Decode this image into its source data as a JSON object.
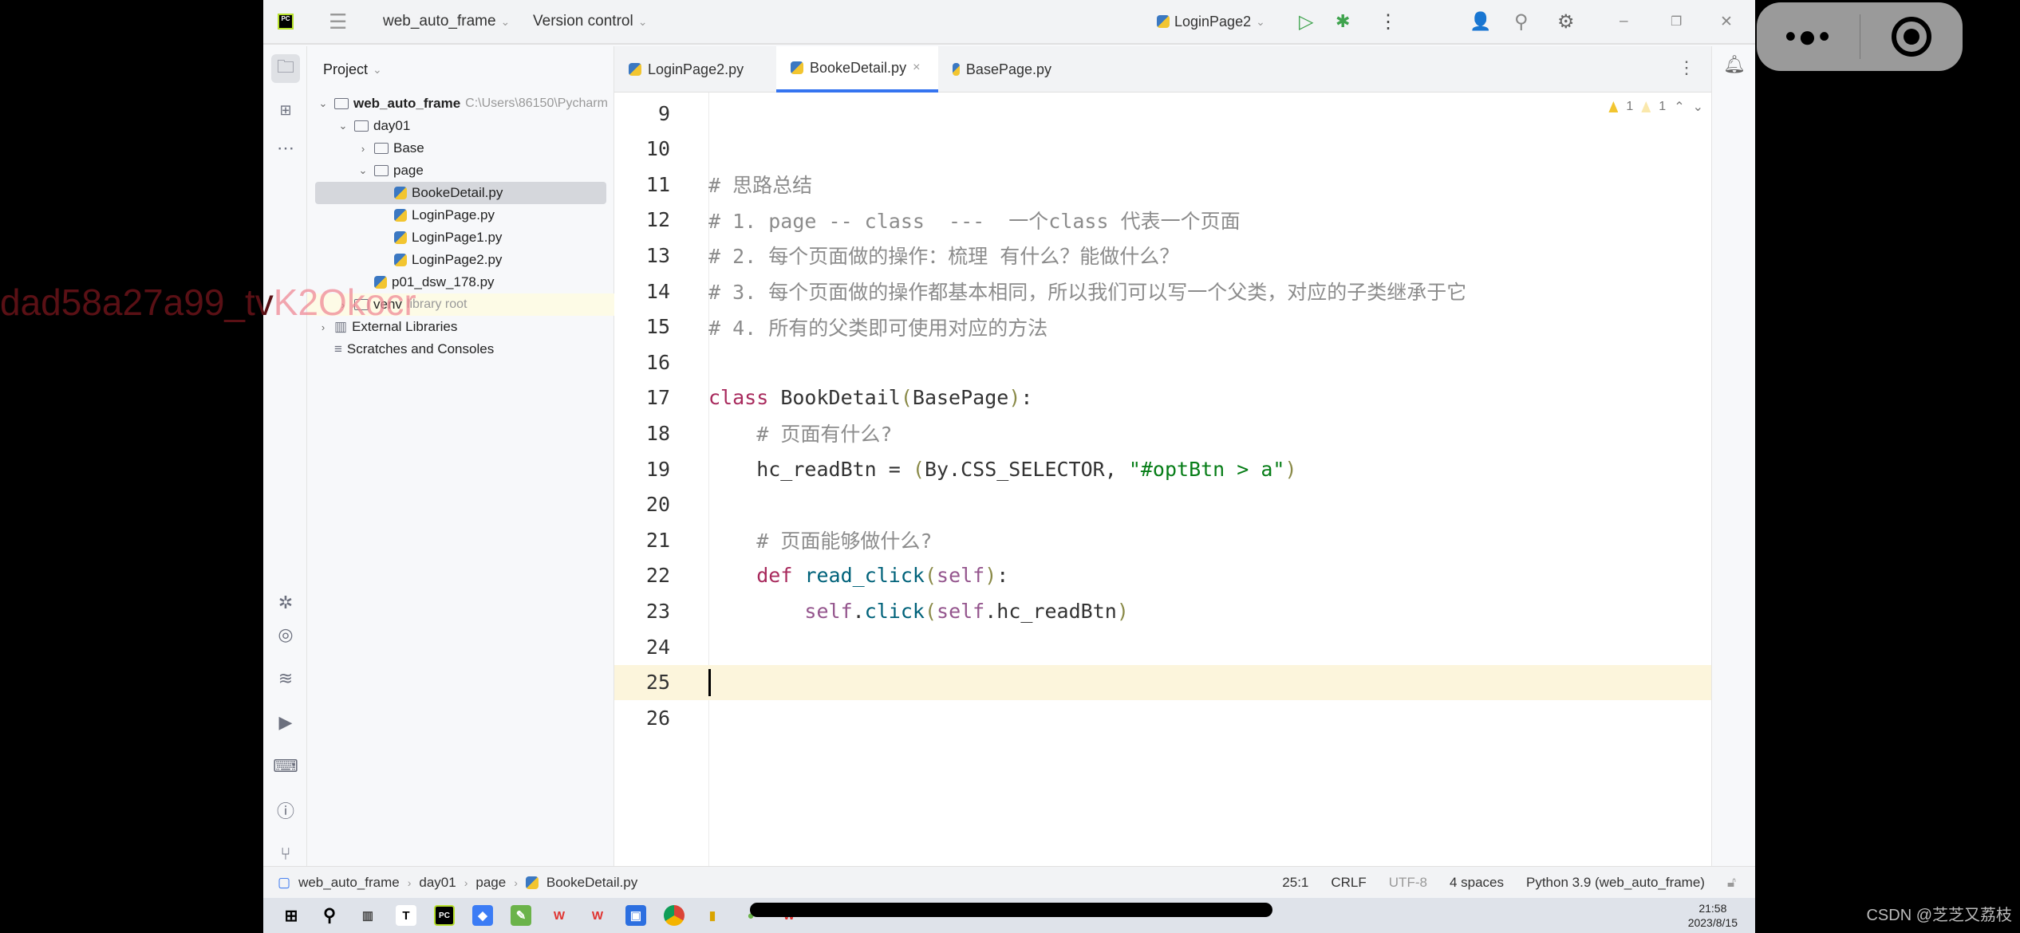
{
  "watermark": {
    "dark": "dad58a27a99_tv",
    "light": "K2Okocr"
  },
  "titlebar": {
    "project": "web_auto_frame",
    "vcs": "Version control",
    "run_config": "LoginPage2"
  },
  "project_panel": {
    "title": "Project",
    "tree": [
      {
        "label": "web_auto_frame",
        "hint": "C:\\Users\\86150\\Pycharm",
        "type": "folder",
        "arrow": "down",
        "depth": 0,
        "bold": true
      },
      {
        "label": "day01",
        "type": "folder",
        "arrow": "down",
        "depth": 1
      },
      {
        "label": "Base",
        "type": "folder",
        "arrow": "right",
        "depth": 2
      },
      {
        "label": "page",
        "type": "folder",
        "arrow": "down",
        "depth": 2
      },
      {
        "label": "BookeDetail.py",
        "type": "py",
        "depth": 3,
        "selected": true
      },
      {
        "label": "LoginPage.py",
        "type": "py",
        "depth": 3
      },
      {
        "label": "LoginPage1.py",
        "type": "py",
        "depth": 3
      },
      {
        "label": "LoginPage2.py",
        "type": "py",
        "depth": 3
      },
      {
        "label": "p01_dsw_178.py",
        "type": "py",
        "depth": 2
      },
      {
        "label": "venv",
        "hint": "library root",
        "type": "folder",
        "arrow": "right",
        "depth": 1,
        "highlight": true
      },
      {
        "label": "External Libraries",
        "type": "lib",
        "arrow": "right",
        "depth": 0
      },
      {
        "label": "Scratches and Consoles",
        "type": "scratch",
        "depth": 0
      }
    ]
  },
  "tabs": [
    {
      "label": "LoginPage2.py",
      "active": false
    },
    {
      "label": "BookeDetail.py",
      "active": true,
      "close": "×"
    },
    {
      "label": "BasePage.py",
      "active": false
    }
  ],
  "inspections": {
    "warnings": "1",
    "weak_warnings": "1"
  },
  "editor": {
    "current_line": 25,
    "lines": [
      {
        "n": "9",
        "t": []
      },
      {
        "n": "10",
        "t": []
      },
      {
        "n": "11",
        "t": [
          [
            "cm",
            "# 思路总结"
          ]
        ]
      },
      {
        "n": "12",
        "t": [
          [
            "cm",
            "# 1. page -- class  ---  一个class 代表一个页面"
          ]
        ]
      },
      {
        "n": "13",
        "t": [
          [
            "cm",
            "# 2. 每个页面做的操作：梳理 有什么？能做什么？"
          ]
        ]
      },
      {
        "n": "14",
        "t": [
          [
            "cm",
            "# 3. 每个页面做的操作都基本相同，所以我们可以写一个父类，对应的子类继承于它"
          ]
        ]
      },
      {
        "n": "15",
        "t": [
          [
            "cm",
            "# 4. 所有的父类即可使用对应的方法"
          ]
        ]
      },
      {
        "n": "16",
        "t": []
      },
      {
        "n": "17",
        "t": [
          [
            "kw",
            "class "
          ],
          [
            "op",
            "BookDetail"
          ],
          [
            "par",
            "("
          ],
          [
            "op",
            "BasePage"
          ],
          [
            "par",
            ")"
          ],
          [
            "op",
            ":"
          ]
        ]
      },
      {
        "n": "18",
        "t": [
          [
            "op",
            "    "
          ],
          [
            "cm",
            "# 页面有什么?"
          ]
        ]
      },
      {
        "n": "19",
        "t": [
          [
            "op",
            "    hc_readBtn = "
          ],
          [
            "par",
            "("
          ],
          [
            "op",
            "By.CSS_SELECTOR, "
          ],
          [
            "str",
            "\"#optBtn > a\""
          ],
          [
            "par",
            ")"
          ]
        ]
      },
      {
        "n": "20",
        "t": []
      },
      {
        "n": "21",
        "t": [
          [
            "op",
            "    "
          ],
          [
            "cm",
            "# 页面能够做什么?"
          ]
        ]
      },
      {
        "n": "22",
        "t": [
          [
            "op",
            "    "
          ],
          [
            "kw",
            "def "
          ],
          [
            "fn",
            "read_click"
          ],
          [
            "par",
            "("
          ],
          [
            "self",
            "self"
          ],
          [
            "par",
            ")"
          ],
          [
            "op",
            ":"
          ]
        ]
      },
      {
        "n": "23",
        "t": [
          [
            "op",
            "        "
          ],
          [
            "self",
            "self"
          ],
          [
            "op",
            "."
          ],
          [
            "fn",
            "click"
          ],
          [
            "par",
            "("
          ],
          [
            "self",
            "self"
          ],
          [
            "op",
            ".hc_readBtn"
          ],
          [
            "par",
            ")"
          ]
        ]
      },
      {
        "n": "24",
        "t": []
      },
      {
        "n": "25",
        "t": []
      },
      {
        "n": "26",
        "t": []
      }
    ]
  },
  "statusbar": {
    "breadcrumb": [
      "web_auto_frame",
      "day01",
      "page",
      "BookeDetail.py"
    ],
    "position": "25:1",
    "line_sep": "CRLF",
    "encoding": "UTF-8",
    "indent": "4 spaces",
    "interpreter": "Python 3.9 (web_auto_frame)"
  },
  "taskbar": {
    "time": "21:58",
    "date": "2023/8/15"
  },
  "overlay": {
    "credit": "CSDN @芝芝又荔枝"
  },
  "colors": {
    "accent": "#3574f0",
    "current_line": "#fcf5dc",
    "keyword": "#a8295c",
    "string": "#067d17",
    "comment": "#8c8c8c"
  }
}
